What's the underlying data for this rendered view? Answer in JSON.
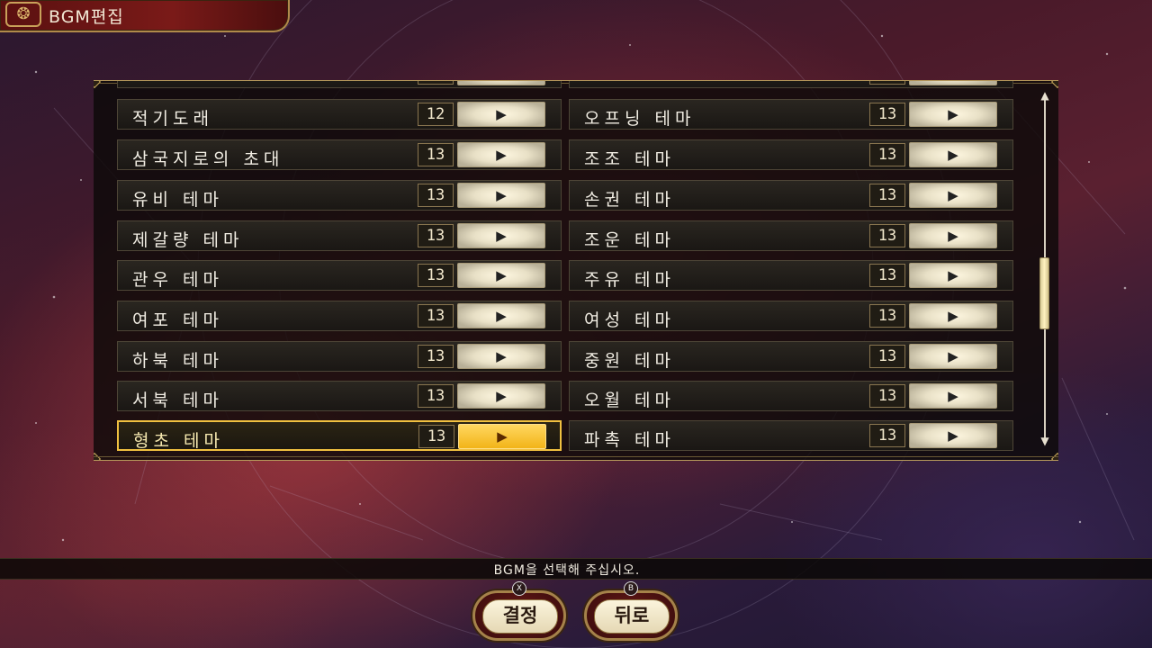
{
  "window": {
    "title": "BGM편집",
    "title_emblem_icon": "title-emblem-icon"
  },
  "list": {
    "left_partial": {
      "num": ""
    },
    "right_partial": {
      "num": ""
    },
    "left": [
      {
        "name": "적기도래",
        "num": "12"
      },
      {
        "name": "삼국지로의 초대",
        "num": "13"
      },
      {
        "name": "유비 테마",
        "num": "13"
      },
      {
        "name": "제갈량 테마",
        "num": "13"
      },
      {
        "name": "관우 테마",
        "num": "13"
      },
      {
        "name": "여포 테마",
        "num": "13"
      },
      {
        "name": "하북 테마",
        "num": "13"
      },
      {
        "name": "서북 테마",
        "num": "13"
      },
      {
        "name": "형초 테마",
        "num": "13",
        "selected": true
      }
    ],
    "right": [
      {
        "name": "오프닝 테마",
        "num": "13"
      },
      {
        "name": "조조 테마",
        "num": "13"
      },
      {
        "name": "손권 테마",
        "num": "13"
      },
      {
        "name": "조운 테마",
        "num": "13"
      },
      {
        "name": "주유 테마",
        "num": "13"
      },
      {
        "name": "여성 테마",
        "num": "13"
      },
      {
        "name": "중원 테마",
        "num": "13"
      },
      {
        "name": "오월 테마",
        "num": "13"
      },
      {
        "name": "파촉 테마",
        "num": "13"
      }
    ],
    "play_symbol": "▶"
  },
  "scrollbar": {
    "up": "▲",
    "down": "▼"
  },
  "status": {
    "text": "BGM을 선택해 주십시오."
  },
  "buttons": {
    "confirm": {
      "label": "결정",
      "glyph": "X"
    },
    "back": {
      "label": "뒤로",
      "glyph": "B"
    }
  },
  "colors": {
    "accent": "#f0c040",
    "frame": "#b5985a"
  }
}
